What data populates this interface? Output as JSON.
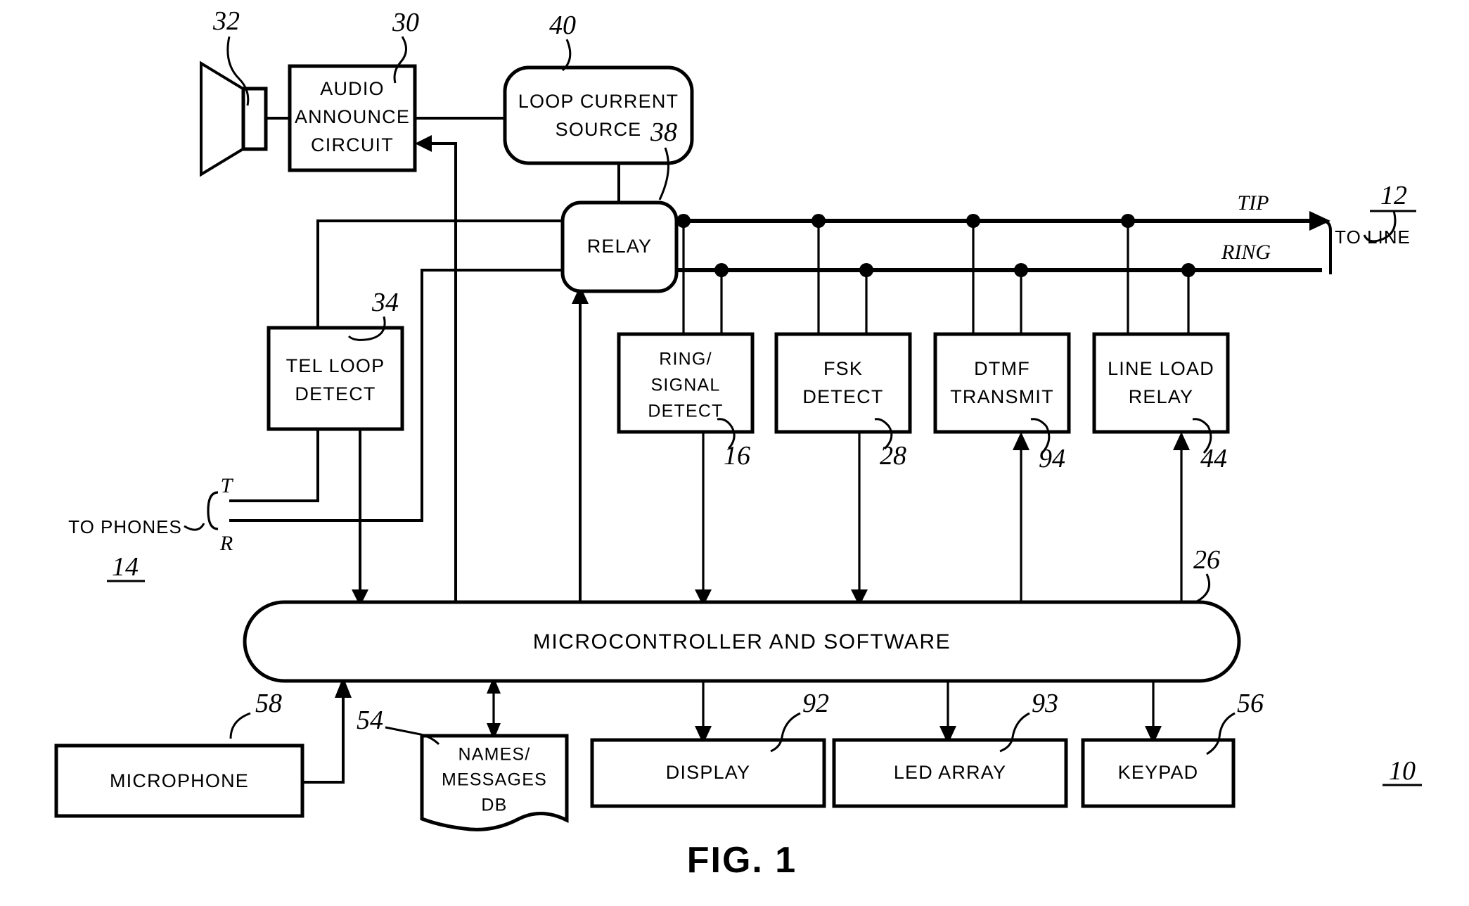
{
  "figure": {
    "caption": "FIG. 1",
    "system_ref": "10"
  },
  "blocks": {
    "audio_announce": {
      "lines": [
        "AUDIO",
        "ANNOUNCE",
        "CIRCUIT"
      ],
      "ref": "30"
    },
    "speaker": {
      "ref": "32"
    },
    "loop_current_source": {
      "lines": [
        "LOOP CURRENT",
        "SOURCE"
      ],
      "ref": "40"
    },
    "relay": {
      "lines": [
        "RELAY"
      ],
      "ref": "38"
    },
    "tel_loop_detect": {
      "lines": [
        "TEL LOOP",
        "DETECT"
      ],
      "ref": "34"
    },
    "ring_signal_detect": {
      "lines": [
        "RING/",
        "SIGNAL",
        "DETECT"
      ],
      "ref": "16"
    },
    "fsk_detect": {
      "lines": [
        "FSK",
        "DETECT"
      ],
      "ref": "28"
    },
    "dtmf_transmit": {
      "lines": [
        "DTMF",
        "TRANSMIT"
      ],
      "ref": "94"
    },
    "line_load_relay": {
      "lines": [
        "LINE LOAD",
        "RELAY"
      ],
      "ref": "44"
    },
    "microcontroller": {
      "lines": [
        "MICROCONTROLLER AND SOFTWARE"
      ],
      "ref": "26"
    },
    "microphone": {
      "lines": [
        "MICROPHONE"
      ],
      "ref": "58"
    },
    "names_messages_db": {
      "lines": [
        "NAMES/",
        "MESSAGES",
        "DB"
      ],
      "ref": "54"
    },
    "display": {
      "lines": [
        "DISPLAY"
      ],
      "ref": "92"
    },
    "led_array": {
      "lines": [
        "LED ARRAY"
      ],
      "ref": "93"
    },
    "keypad": {
      "lines": [
        "KEYPAD"
      ],
      "ref": "56"
    }
  },
  "labels": {
    "tip": "TIP",
    "ring": "RING",
    "to_line": "TO LINE",
    "to_line_ref": "12",
    "to_phones": "TO PHONES",
    "to_phones_ref": "14",
    "terminal_t": "T",
    "terminal_r": "R"
  },
  "colors": {
    "ink": "#000000",
    "paper": "#ffffff"
  }
}
